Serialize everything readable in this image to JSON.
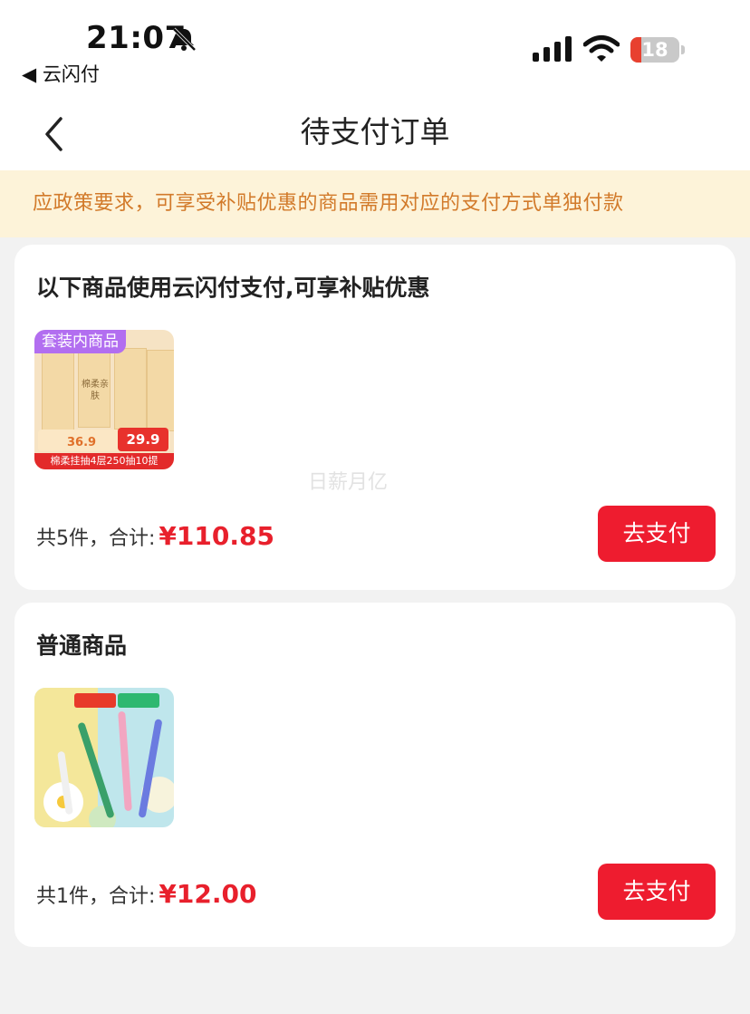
{
  "status_bar": {
    "time": "21:07",
    "back_app": "◀ 云闪付",
    "battery_level": "18",
    "icons": [
      "bell-slash-icon",
      "signal-icon",
      "wifi-icon",
      "battery-icon"
    ]
  },
  "nav": {
    "title": "待支付订单",
    "back_icon": "chevron-left-icon"
  },
  "notice": {
    "text": "应政策要求，可享受补贴优惠的商品需用对应的支付方式单独付款"
  },
  "watermark": "日薪月亿",
  "orders": [
    {
      "title": "以下商品使用云闪付支付,可享补贴优惠",
      "summary": "共5件，合计:",
      "total": "¥110.85",
      "pay_label": "去支付",
      "product": {
        "tag": "套装内商品",
        "box_text": "棉柔亲肤",
        "old_price": "36.9",
        "new_price": "29.9",
        "strip_text": "棉柔挂抽4层250抽10提"
      }
    },
    {
      "title": "普通商品",
      "summary": "共1件，合计:",
      "total": "¥12.00",
      "pay_label": "去支付",
      "product": {
        "image_icon": "gel-pens-product-image"
      }
    }
  ],
  "colors": {
    "accent": "#ee1c2f",
    "price": "#e8202c",
    "notice_bg": "#fdf3d9",
    "notice_text": "#d27a2a",
    "page_bg": "#f2f2f2"
  }
}
